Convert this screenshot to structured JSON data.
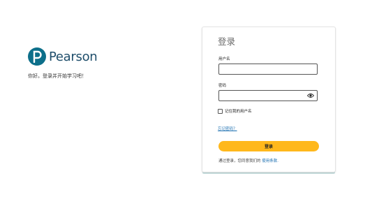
{
  "brand": {
    "logo_text": "Pearson",
    "tagline": "你好。登录并开始学习吧！"
  },
  "form": {
    "title": "登录",
    "username_label": "用户名",
    "username_value": "",
    "password_label": "密码",
    "password_value": "",
    "remember_label": "记住我的用户名",
    "remember_checked": false,
    "forgot_link": "忘记密码？",
    "signin_button": "登录",
    "terms_prefix": "通过登录，您同意我们的",
    "terms_link": "使用条款."
  },
  "colors": {
    "brand": "#0d6f8a",
    "button": "#ffb81c",
    "link": "#1a6eb0"
  },
  "icons": {
    "logo": "pearson-logo-icon",
    "password_toggle": "eye-icon"
  }
}
